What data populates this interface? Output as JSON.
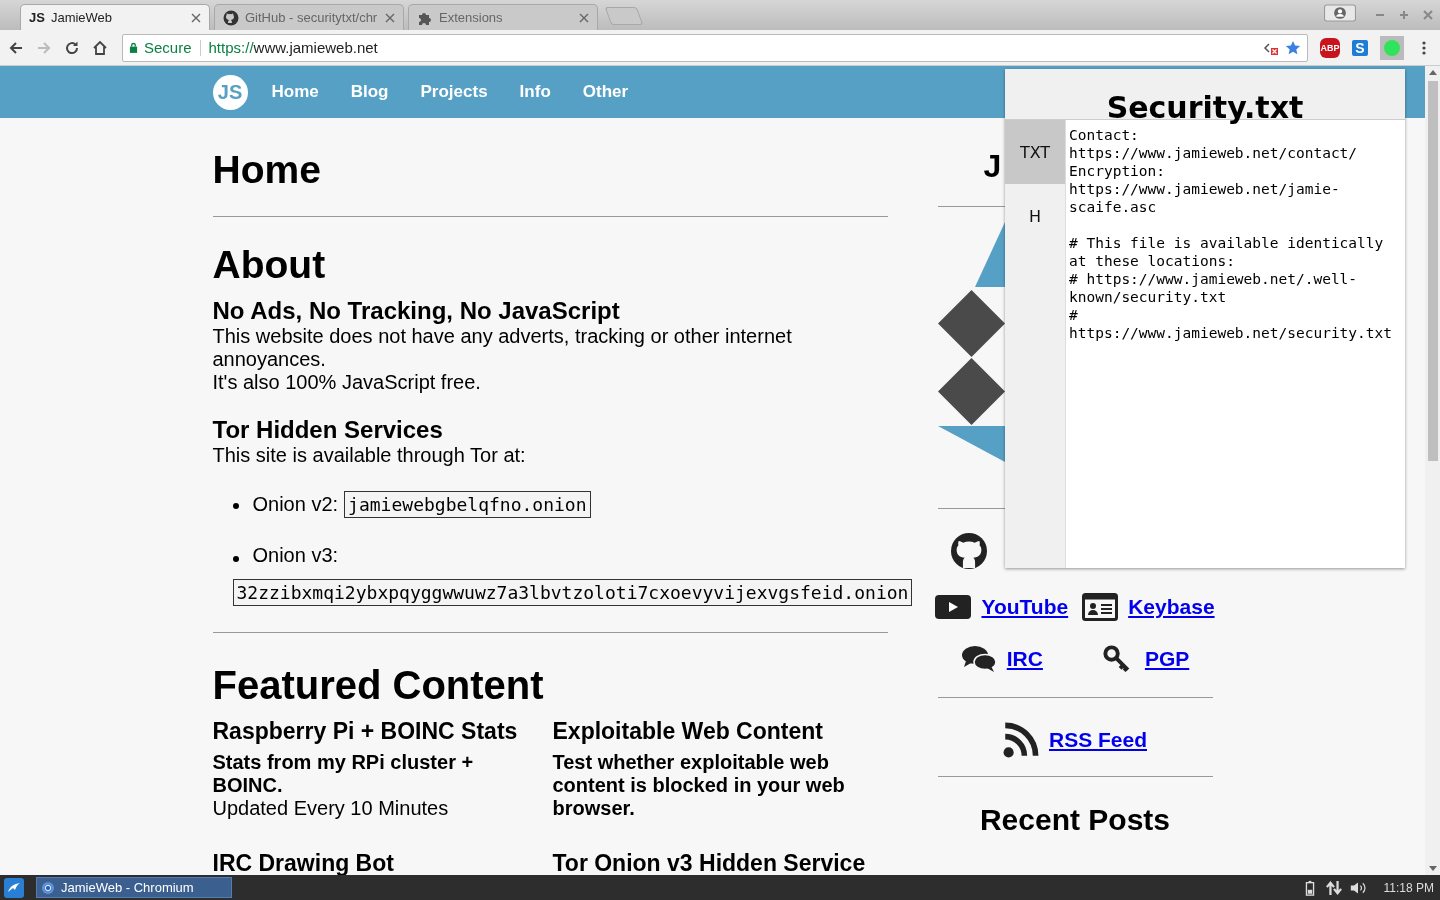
{
  "browser": {
    "tabs": [
      {
        "favicon": "JS",
        "title": "JamieWeb",
        "kind": "text",
        "selected": true
      },
      {
        "title": "GitHub - securitytxt/chr",
        "kind": "github",
        "selected": false
      },
      {
        "title": "Extensions",
        "kind": "puzzle",
        "selected": false
      }
    ],
    "address": {
      "secure_label": "Secure",
      "scheme": "https://",
      "host": "www.jamieweb.net"
    },
    "extensions": [
      {
        "kind": "abp",
        "label": "ABP"
      },
      {
        "kind": "s",
        "label": "S"
      },
      {
        "kind": "dot"
      }
    ]
  },
  "nav": {
    "logo": "JS",
    "items": [
      "Home",
      "Blog",
      "Projects",
      "Info",
      "Other"
    ]
  },
  "main": {
    "title": "Home",
    "about": {
      "heading": "About",
      "subheading": "No Ads, No Tracking, No JavaScript",
      "paragraphs": [
        "This website does not have any adverts, tracking or other internet annoyances.",
        "It's also 100% JavaScript free."
      ]
    },
    "tor": {
      "heading": "Tor Hidden Services",
      "intro": "This site is available through Tor at:",
      "onions": [
        {
          "label": "Onion v2:",
          "address": "jamiewebgbelqfno.onion"
        },
        {
          "label": "Onion v3:",
          "address": "32zzibxmqi2ybxpqyggwwuwz7a3lbvtzoloti7cxoevyvijexvgsfeid.onion"
        }
      ]
    },
    "featured": {
      "heading": "Featured Content",
      "items": [
        {
          "title": "Raspberry Pi + BOINC Stats",
          "summary": "Stats from my RPi cluster + BOINC.",
          "note": "Updated Every 10 Minutes"
        },
        {
          "title": "Exploitable Web Content",
          "summary": "Test whether exploitable web content is blocked in your web browser."
        },
        {
          "title": "IRC Drawing Bot"
        },
        {
          "title": "Tor Onion v3 Hidden Service"
        }
      ]
    }
  },
  "sidebar": {
    "heading": "J",
    "links": [
      [
        {
          "kind": "github"
        }
      ],
      [
        {
          "kind": "youtube",
          "label": "YouTube"
        },
        {
          "kind": "idcard",
          "label": "Keybase"
        }
      ],
      [
        {
          "kind": "chat",
          "label": "IRC"
        },
        {
          "kind": "key",
          "label": "PGP"
        }
      ]
    ],
    "rss": "RSS Feed",
    "recent_heading": "Recent Posts"
  },
  "popup": {
    "title": "Security.txt",
    "tabs": [
      {
        "label": "TXT",
        "selected": true
      },
      {
        "label": "H",
        "selected": false
      }
    ],
    "content": "Contact:\nhttps://www.jamieweb.net/contact/\nEncryption:\nhttps://www.jamieweb.net/jamie-\nscaife.asc\n\n# This file is available identically\nat these locations:\n# https://www.jamieweb.net/.well-\nknown/security.txt\n#\nhttps://www.jamieweb.net/security.txt"
  },
  "taskbar": {
    "task": "JamieWeb - Chromium",
    "clock": "11:18 PM"
  }
}
